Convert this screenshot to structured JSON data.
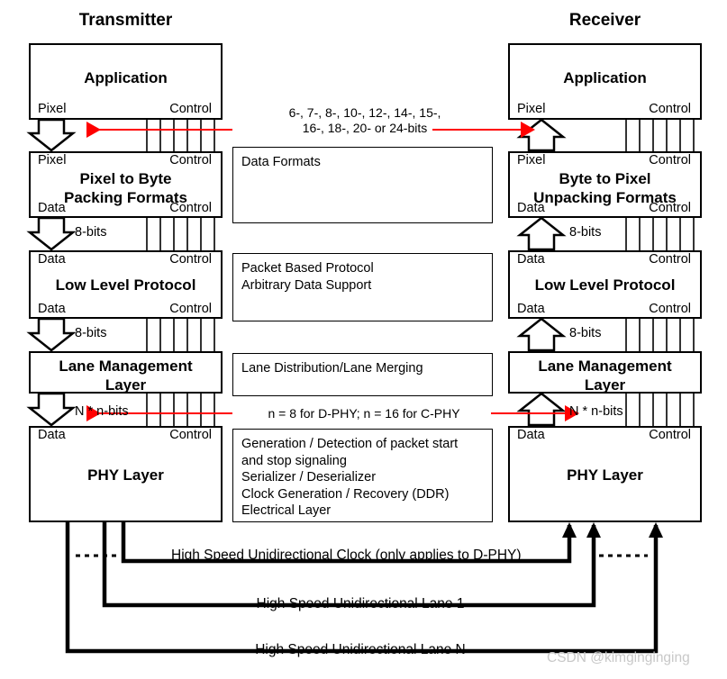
{
  "titles": {
    "transmitter": "Transmitter",
    "receiver": "Receiver"
  },
  "transmitter": {
    "layers": [
      {
        "name": "Application",
        "top_left": "",
        "top_right": "",
        "bottom_left": "Pixel",
        "bottom_right": "Control"
      },
      {
        "name": "Pixel to Byte\nPacking Formats",
        "top_left": "Pixel",
        "top_right": "Control",
        "bottom_left": "Data",
        "bottom_right": "Control"
      },
      {
        "name": "Low Level Protocol",
        "top_left": "Data",
        "top_right": "Control",
        "bottom_left": "Data",
        "bottom_right": "Control"
      },
      {
        "name": "Lane Management\nLayer",
        "top_left": "",
        "top_right": "",
        "bottom_left": "",
        "bottom_right": ""
      },
      {
        "name": "PHY Layer",
        "top_left": "Data",
        "top_right": "Control",
        "bottom_left": "",
        "bottom_right": ""
      }
    ],
    "bus_labels": [
      "8-bits",
      "8-bits",
      "N * n-bits"
    ]
  },
  "receiver": {
    "layers": [
      {
        "name": "Application",
        "top_left": "",
        "top_right": "",
        "bottom_left": "Pixel",
        "bottom_right": "Control"
      },
      {
        "name": "Byte to Pixel\nUnpacking Formats",
        "top_left": "Pixel",
        "top_right": "Control",
        "bottom_left": "Data",
        "bottom_right": "Control"
      },
      {
        "name": "Low Level Protocol",
        "top_left": "Data",
        "top_right": "Control",
        "bottom_left": "Data",
        "bottom_right": "Control"
      },
      {
        "name": "Lane Management\nLayer",
        "top_left": "",
        "top_right": "",
        "bottom_left": "",
        "bottom_right": ""
      },
      {
        "name": "PHY Layer",
        "top_left": "Data",
        "top_right": "Control",
        "bottom_left": "",
        "bottom_right": ""
      }
    ],
    "bus_labels": [
      "8-bits",
      "8-bits",
      "N * n-bits"
    ]
  },
  "descriptions": [
    {
      "id": "data-formats",
      "text": "Data Formats"
    },
    {
      "id": "protocol",
      "text": "Packet Based Protocol\nArbitrary Data Support"
    },
    {
      "id": "lane",
      "text": "Lane Distribution/Lane Merging"
    },
    {
      "id": "phy",
      "text": "Generation / Detection of packet start\nand stop signaling\nSerializer / Deserializer\nClock Generation / Recovery (DDR)\nElectrical Layer"
    }
  ],
  "red_annotations": [
    {
      "id": "pixel-width",
      "text": "6-, 7-, 8-, 10-, 12-, 14-, 15-,\n16-, 18-, 20- or 24-bits"
    },
    {
      "id": "phy-lane-width",
      "text": "n =  8  for D-PHY; n = 16 for C-PHY"
    }
  ],
  "links": [
    {
      "id": "clock",
      "label": "High Speed Unidirectional Clock (only applies to D-PHY)"
    },
    {
      "id": "lane1",
      "label": "High Speed Unidirectional Lane 1"
    },
    {
      "id": "laneN",
      "label": "High Speed Unidirectional Lane N"
    }
  ],
  "watermark": "CSDN @kimginginging",
  "colors": {
    "line": "#000000",
    "accent_red": "#ff0000",
    "watermark": "#c8c8c8",
    "background": "#ffffff"
  }
}
